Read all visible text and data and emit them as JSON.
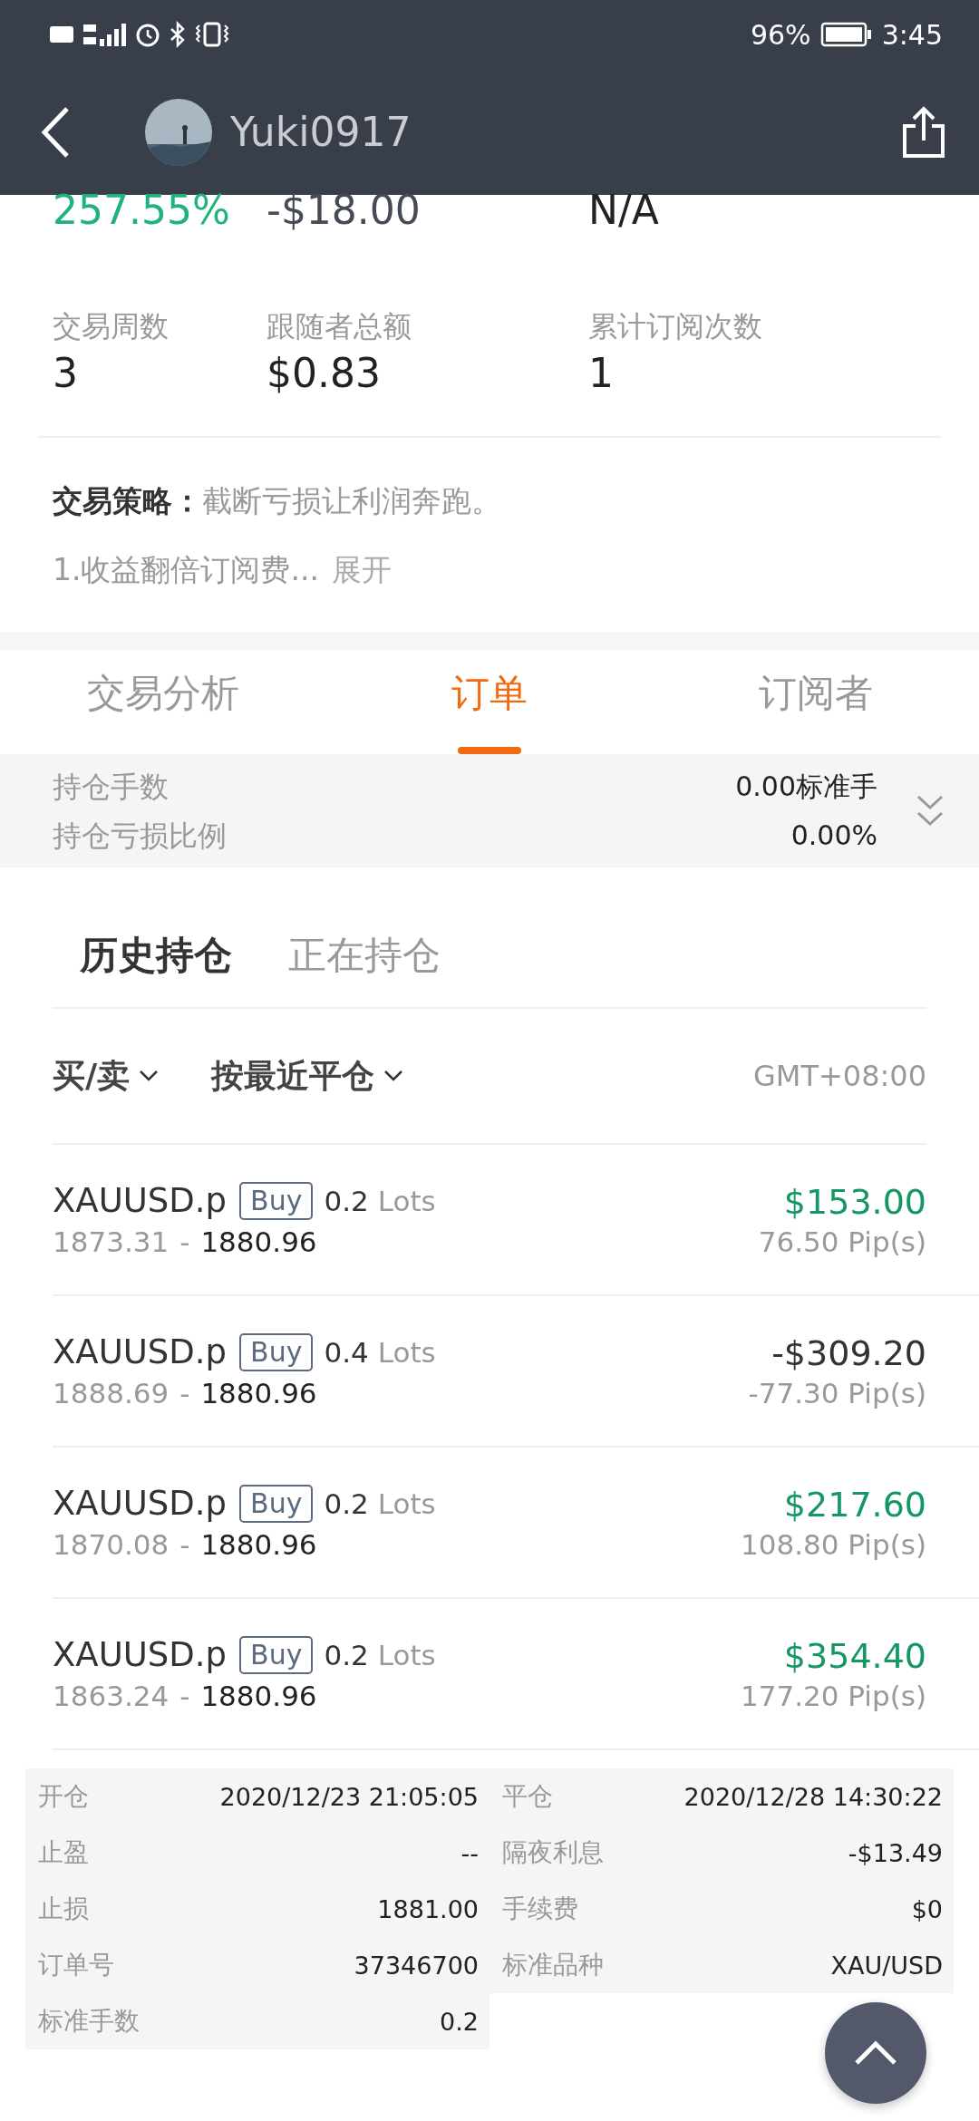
{
  "status_bar": {
    "battery": "96%",
    "time": "3:45"
  },
  "header": {
    "username": "Yuki0917"
  },
  "stats_top": [
    {
      "value": "257.55%",
      "kind": "gain"
    },
    {
      "value": "-$18.00",
      "kind": "loss"
    },
    {
      "value": "N/A",
      "kind": "plain"
    }
  ],
  "stats": [
    {
      "label": "交易周数",
      "value": "3"
    },
    {
      "label": "跟随者总额",
      "value": "$0.83"
    },
    {
      "label": "累计订阅次数",
      "value": "1"
    }
  ],
  "strategy": {
    "label": "交易策略：",
    "text": "截断亏损让利润奔跑。",
    "preview": "1.收益翻倍订阅费...",
    "expand": "展开"
  },
  "tabs": [
    {
      "label": "交易分析",
      "selected": false
    },
    {
      "label": "订单",
      "selected": true
    },
    {
      "label": "订阅者",
      "selected": false
    }
  ],
  "summary": [
    {
      "label": "持仓手数",
      "value": "0.00标准手"
    },
    {
      "label": "持仓亏损比例",
      "value": "0.00%"
    }
  ],
  "sub_tabs": [
    {
      "label": "历史持仓",
      "selected": true
    },
    {
      "label": "正在持仓",
      "selected": false
    }
  ],
  "filters": [
    {
      "label": "买/卖"
    },
    {
      "label": "按最近平仓"
    }
  ],
  "timezone": "GMT+08:00",
  "orders": [
    {
      "symbol": "XAUUSD.p",
      "side": "Buy",
      "lots": "0.2",
      "lots_unit": "Lots",
      "open": "1873.31",
      "separator": "-",
      "close": "1880.96",
      "profit": "$153.00",
      "positive": true,
      "pips": "76.50 Pip(s)"
    },
    {
      "symbol": "XAUUSD.p",
      "side": "Buy",
      "lots": "0.4",
      "lots_unit": "Lots",
      "open": "1888.69",
      "separator": "-",
      "close": "1880.96",
      "profit": "-$309.20",
      "positive": false,
      "pips": "-77.30 Pip(s)"
    },
    {
      "symbol": "XAUUSD.p",
      "side": "Buy",
      "lots": "0.2",
      "lots_unit": "Lots",
      "open": "1870.08",
      "separator": "-",
      "close": "1880.96",
      "profit": "$217.60",
      "positive": true,
      "pips": "108.80 Pip(s)"
    },
    {
      "symbol": "XAUUSD.p",
      "side": "Buy",
      "lots": "0.2",
      "lots_unit": "Lots",
      "open": "1863.24",
      "separator": "-",
      "close": "1880.96",
      "profit": "$354.40",
      "positive": true,
      "pips": "177.20 Pip(s)"
    }
  ],
  "details": [
    {
      "label": "开仓",
      "value": "2020/12/23 21:05:05"
    },
    {
      "label": "平仓",
      "value": "2020/12/28 14:30:22"
    },
    {
      "label": "止盈",
      "value": "--"
    },
    {
      "label": "隔夜利息",
      "value": "-$13.49"
    },
    {
      "label": "止损",
      "value": "1881.00"
    },
    {
      "label": "手续费",
      "value": "$0"
    },
    {
      "label": "订单号",
      "value": "37346700"
    },
    {
      "label": "标准品种",
      "value": "XAU/USD"
    },
    {
      "label": "标准手数",
      "value": "0.2"
    }
  ]
}
